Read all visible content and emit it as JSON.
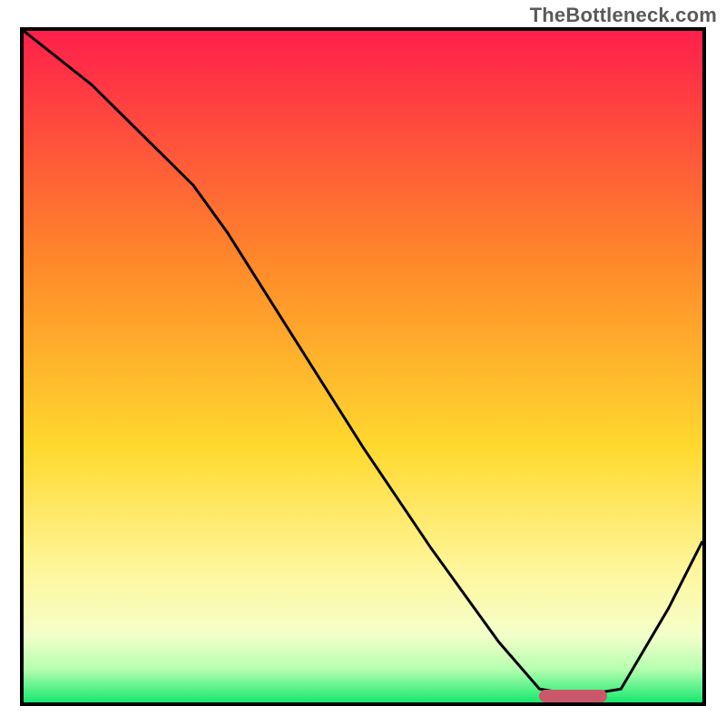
{
  "watermark": "TheBottleneck.com",
  "colors": {
    "top": "#ff1f4b",
    "mid_upper": "#ff8a2a",
    "mid": "#ffd92e",
    "mid_lower": "#fff69a",
    "pale": "#f4ffc9",
    "green_light": "#b6ffb0",
    "green": "#17e86f",
    "frame": "#000000",
    "marker": "#c9596a"
  },
  "chart_data": {
    "type": "line",
    "title": "",
    "xlabel": "",
    "ylabel": "",
    "xlim": [
      0,
      100
    ],
    "ylim": [
      0,
      100
    ],
    "series": [
      {
        "name": "bottleneck-curve",
        "x": [
          0,
          10,
          20,
          25,
          30,
          40,
          50,
          60,
          70,
          76,
          82,
          88,
          95,
          100
        ],
        "y": [
          100,
          92,
          82,
          77,
          70,
          54,
          38,
          23,
          9,
          2,
          1,
          2,
          14,
          24
        ]
      }
    ],
    "annotations": [
      {
        "name": "optimal-marker",
        "x_start": 76,
        "x_end": 86,
        "y": 1
      }
    ],
    "gradient_stops": [
      {
        "pct": 0,
        "color": "#ff1f4b"
      },
      {
        "pct": 35,
        "color": "#ff8a2a"
      },
      {
        "pct": 62,
        "color": "#ffd92e"
      },
      {
        "pct": 80,
        "color": "#fff69a"
      },
      {
        "pct": 90,
        "color": "#f4ffc9"
      },
      {
        "pct": 95,
        "color": "#b6ffb0"
      },
      {
        "pct": 100,
        "color": "#17e86f"
      }
    ]
  }
}
